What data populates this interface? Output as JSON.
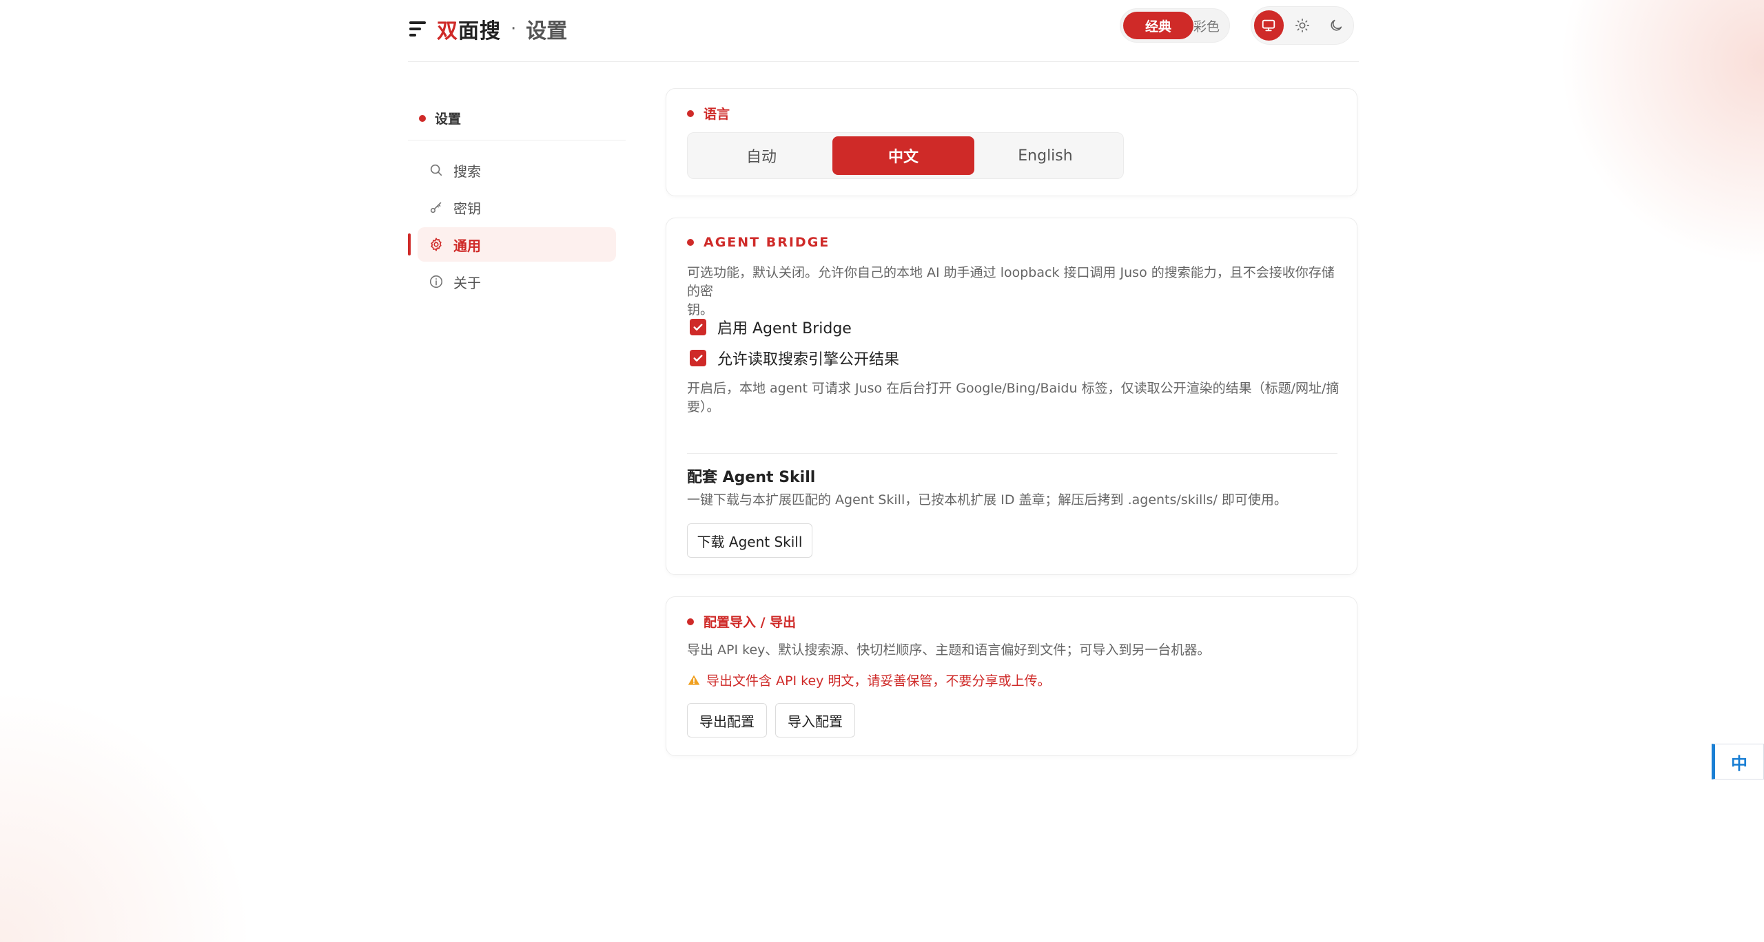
{
  "header": {
    "brand_part1": "双",
    "brand_part2": "面搜",
    "separator": "·",
    "page_title": "设置",
    "style_switch": {
      "active": "经典",
      "inactive": "彩色"
    },
    "theme_icons": [
      "monitor-icon",
      "sun-icon",
      "moon-icon"
    ]
  },
  "sidebar": {
    "heading": "设置",
    "items": [
      {
        "label": "搜索",
        "icon": "search-icon"
      },
      {
        "label": "密钥",
        "icon": "key-icon"
      },
      {
        "label": "通用",
        "icon": "gear-icon",
        "active": true
      },
      {
        "label": "关于",
        "icon": "info-icon"
      }
    ]
  },
  "language": {
    "title": "语言",
    "options": [
      "自动",
      "中文",
      "English"
    ],
    "selected": "中文"
  },
  "agent_bridge": {
    "title": "AGENT BRIDGE",
    "description_line1": "可选功能，默认关闭。允许你自己的本地 AI 助手通过 loopback 接口调用 Juso 的搜索能力，且不会接收你存储的密",
    "description_line2": "钥。",
    "checkbox_enable": "启用 Agent Bridge",
    "checkbox_allow": "允许读取搜索引擎公开结果",
    "note_line1": "开启后，本地 agent 可请求 Juso 在后台打开 Google/Bing/Baidu 标签，仅读取公开渲染的结果（标题/网址/摘",
    "note_line2": "要）。",
    "skill_title": "配套 Agent Skill",
    "skill_desc": "一键下载与本扩展匹配的 Agent Skill，已按本机扩展 ID 盖章；解压后拷到 .agents/skills/ 即可使用。",
    "download_button": "下载 Agent Skill"
  },
  "config_io": {
    "title": "配置导入 / 导出",
    "description": "导出 API key、默认搜索源、快切栏顺序、主题和语言偏好到文件；可导入到另一台机器。",
    "warning": "导出文件含 API key 明文，请妥善保管，不要分享或上传。",
    "export_button": "导出配置",
    "import_button": "导入配置"
  },
  "ime": {
    "label": "中"
  },
  "colors": {
    "accent": "#cf2a28",
    "ime_blue": "#1a7fd4"
  }
}
